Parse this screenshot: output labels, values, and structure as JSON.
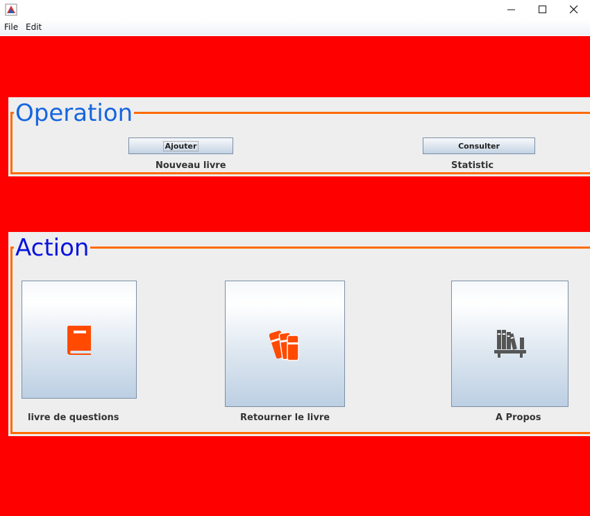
{
  "window": {
    "icons": [
      "java-app-icon",
      "minimize-icon",
      "maximize-icon",
      "close-icon"
    ]
  },
  "menu": {
    "file_label": "File",
    "edit_label": "Edit"
  },
  "operation": {
    "legend": "Operation",
    "ajouter_label": "Ajouter",
    "nouveau_label": "Nouveau livre",
    "consulter_label": "Consulter",
    "statistic_label": "Statistic"
  },
  "action": {
    "legend": "Action",
    "items": [
      {
        "label": "livre de questions",
        "icon": "book-icon"
      },
      {
        "label": "Retourner le livre",
        "icon": "books-icon"
      },
      {
        "label": "A Propos",
        "icon": "bookshelf-icon"
      }
    ]
  },
  "colors": {
    "background": "#ff0000",
    "panel": "#eeeeee",
    "border": "#ff6a00",
    "operation_legend": "#1565e0",
    "action_legend": "#0a13dd",
    "icon_orange": "#ff4a00",
    "icon_gray": "#555555"
  }
}
